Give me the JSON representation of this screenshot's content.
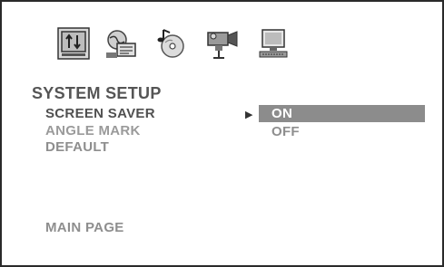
{
  "icons": [
    {
      "name": "system-setup-icon"
    },
    {
      "name": "language-setup-icon"
    },
    {
      "name": "audio-setup-icon"
    },
    {
      "name": "video-setup-icon"
    },
    {
      "name": "preference-setup-icon"
    }
  ],
  "menu": {
    "title": "SYSTEM SETUP",
    "items": [
      {
        "label": "SCREEN SAVER",
        "state": "active"
      },
      {
        "label": "ANGLE MARK",
        "state": "inactive"
      },
      {
        "label": "DEFAULT",
        "state": "inactive"
      }
    ],
    "footer": "MAIN PAGE"
  },
  "submenu": {
    "pointer": "▶",
    "options": [
      {
        "label": "ON",
        "selected": true
      },
      {
        "label": "OFF",
        "selected": false
      }
    ]
  },
  "colors": {
    "highlight": "#8c8c8c",
    "active_text": "#505050",
    "inactive_text": "#9a9a9a"
  }
}
